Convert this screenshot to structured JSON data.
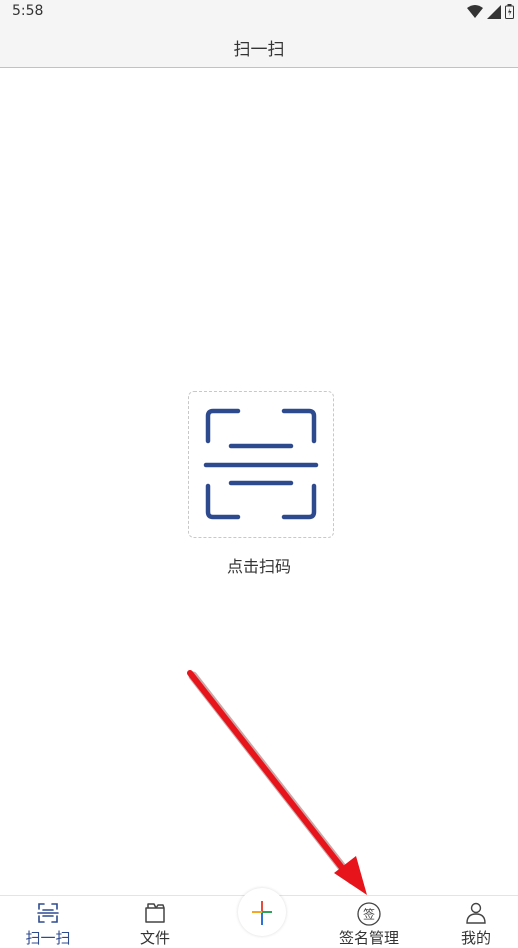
{
  "status_bar": {
    "time": "5:58",
    "icons": [
      "wifi-icon",
      "cell-signal-icon",
      "battery-icon"
    ]
  },
  "header": {
    "title": "扫一扫"
  },
  "main": {
    "scan_button_icon": "scan-frame-icon",
    "scan_label": "点击扫码",
    "accent_color": "#2e4a8f"
  },
  "bottom_nav": {
    "items": [
      {
        "label": "扫一扫",
        "icon": "scan-icon",
        "active": true
      },
      {
        "label": "文件",
        "icon": "folder-icon",
        "active": false
      },
      {
        "label": "",
        "icon": "plus-icon",
        "active": false
      },
      {
        "label": "签名管理",
        "icon": "signature-icon",
        "active": false
      },
      {
        "label": "我的",
        "icon": "person-icon",
        "active": false
      }
    ]
  },
  "annotation": {
    "type": "arrow",
    "color": "#e8141c",
    "target": "签名管理"
  }
}
